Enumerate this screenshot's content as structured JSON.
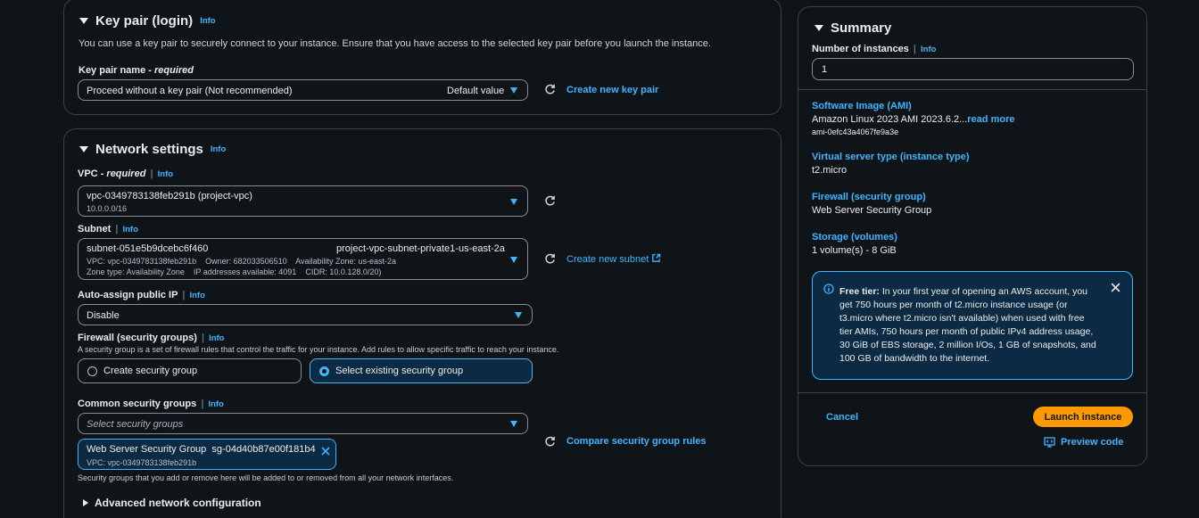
{
  "key_pair": {
    "title": "Key pair (login)",
    "info": "Info",
    "description": "You can use a key pair to securely connect to your instance. Ensure that you have access to the selected key pair before you launch the instance.",
    "name_label": "Key pair name",
    "required": "- required",
    "selected_value": "Proceed without a key pair (Not recommended)",
    "default_tag": "Default value",
    "create_link": "Create new key pair"
  },
  "network": {
    "title": "Network settings",
    "info": "Info",
    "vpc_label": "VPC",
    "vpc_required": "- required",
    "vpc_info": "Info",
    "vpc_value": "vpc-0349783138feb291b (project-vpc)",
    "vpc_cidr": "10.0.0.0/16",
    "subnet_label": "Subnet",
    "subnet_info": "Info",
    "subnet_id": "subnet-051e5b9dcebc6f460",
    "subnet_name": "project-vpc-subnet-private1-us-east-2a",
    "subnet_line2": "VPC: vpc-0349783138feb291b    Owner: 682033506510    Availability Zone: us-east-2a",
    "subnet_line3": "Zone type: Availability Zone    IP addresses available: 4091    CIDR: 10.0.128.0/20)",
    "create_subnet": "Create new subnet",
    "public_ip_label": "Auto-assign public IP",
    "public_ip_info": "Info",
    "public_ip_value": "Disable",
    "firewall_label": "Firewall (security groups)",
    "firewall_info": "Info",
    "firewall_desc": "A security group is a set of firewall rules that control the traffic for your instance. Add rules to allow specific traffic to reach your instance.",
    "create_sg": "Create security group",
    "select_sg": "Select existing security group",
    "common_sg_label": "Common security groups",
    "common_sg_info": "Info",
    "sg_placeholder": "Select security groups",
    "compare_link": "Compare security group rules",
    "token_name": "Web Server Security Group",
    "token_id": "sg-04d40b87e00f181b4",
    "token_vpc": "VPC: vpc-0349783138feb291b",
    "sg_note": "Security groups that you add or remove here will be added to or removed from all your network interfaces.",
    "advanced": "Advanced network configuration"
  },
  "summary": {
    "title": "Summary",
    "instances_label": "Number of instances",
    "instances_info": "Info",
    "instances_value": "1",
    "ami_label": "Software Image (AMI)",
    "ami_value": "Amazon Linux 2023 AMI 2023.6.2...",
    "read_more": "read more",
    "ami_id": "ami-0efc43a4067fe9a3e",
    "type_label": "Virtual server type (instance type)",
    "type_value": "t2.micro",
    "firewall_label": "Firewall (security group)",
    "firewall_value": "Web Server Security Group",
    "storage_label": "Storage (volumes)",
    "storage_value": "1 volume(s) - 8 GiB",
    "free_tier_title": "Free tier:",
    "free_tier_text": "In your first year of opening an AWS account, you get 750 hours per month of t2.micro instance usage (or t3.micro where t2.micro isn't available) when used with free tier AMIs, 750 hours per month of public IPv4 address usage, 30 GiB of EBS storage, 2 million I/Os, 1 GB of snapshots, and 100 GB of bandwidth to the internet.",
    "cancel": "Cancel",
    "launch": "Launch instance",
    "preview": "Preview code"
  }
}
